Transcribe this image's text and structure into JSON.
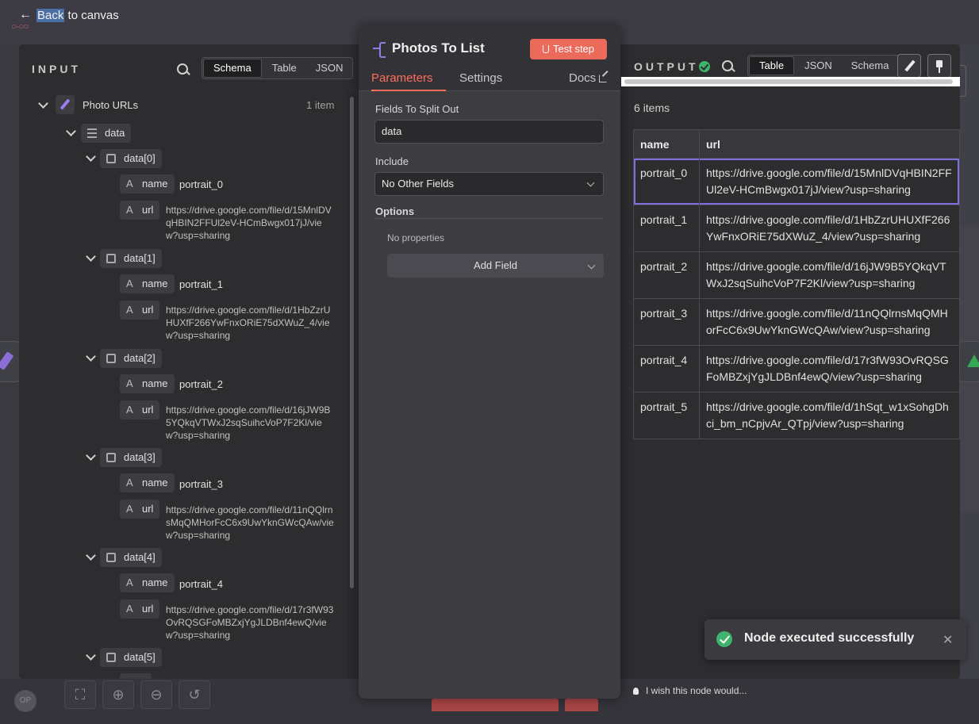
{
  "back_link": {
    "back": "Back",
    "rest": "to canvas"
  },
  "input": {
    "heading": "INPUT",
    "views": [
      "Schema",
      "Table",
      "JSON"
    ],
    "active_view": "Schema",
    "root": {
      "label": "Photo URLs",
      "count": "1 item"
    },
    "data_label": "data",
    "items": [
      {
        "label": "data[0]",
        "name_key": "name",
        "name": "portrait_0",
        "url_key": "url",
        "url": "https://drive.google.com/file/d/15MnlDVqHBIN2FFUl2eV-HCmBwgx017jJ/view?usp=sharing"
      },
      {
        "label": "data[1]",
        "name_key": "name",
        "name": "portrait_1",
        "url_key": "url",
        "url": "https://drive.google.com/file/d/1HbZzrUHUXfF266YwFnxORiE75dXWuZ_4/view?usp=sharing"
      },
      {
        "label": "data[2]",
        "name_key": "name",
        "name": "portrait_2",
        "url_key": "url",
        "url": "https://drive.google.com/file/d/16jJW9B5YQkqVTWxJ2sqSuihcVoP7F2Kl/view?usp=sharing"
      },
      {
        "label": "data[3]",
        "name_key": "name",
        "name": "portrait_3",
        "url_key": "url",
        "url": "https://drive.google.com/file/d/11nQQlrnsMqQMHorFcC6x9UwYknGWcQAw/view?usp=sharing"
      },
      {
        "label": "data[4]",
        "name_key": "name",
        "name": "portrait_4",
        "url_key": "url",
        "url": "https://drive.google.com/file/d/17r3fW93OvRQSGFoMBZxjYgJLDBnf4ewQ/view?usp=sharing"
      },
      {
        "label": "data[5]"
      }
    ]
  },
  "node": {
    "title": "Photos To List",
    "test_button": "Test step",
    "tabs": [
      "Parameters",
      "Settings"
    ],
    "docs": "Docs",
    "fields_to_split_label": "Fields To Split Out",
    "fields_to_split_value": "data",
    "include_label": "Include",
    "include_value": "No Other Fields",
    "options_label": "Options",
    "no_properties": "No properties",
    "add_field": "Add Field"
  },
  "output": {
    "heading": "OUTPUT",
    "views": [
      "Table",
      "JSON",
      "Schema"
    ],
    "active_view": "Table",
    "items_count": "6 items",
    "columns": [
      "name",
      "url"
    ],
    "rows": [
      [
        "portrait_0",
        "https://drive.google.com/file/d/15MnlDVqHBIN2FFUl2eV-HCmBwgx017jJ/view?usp=sharing"
      ],
      [
        "portrait_1",
        "https://drive.google.com/file/d/1HbZzrUHUXfF266YwFnxORiE75dXWuZ_4/view?usp=sharing"
      ],
      [
        "portrait_2",
        "https://drive.google.com/file/d/16jJW9B5YQkqVTWxJ2sqSuihcVoP7F2Kl/view?usp=sharing"
      ],
      [
        "portrait_3",
        "https://drive.google.com/file/d/11nQQlrnsMqQMHorFcC6x9UwYknGWcQAw/view?usp=sharing"
      ],
      [
        "portrait_4",
        "https://drive.google.com/file/d/17r3fW93OvRQSGFoMBZxjYgJLDBnf4ewQ/view?usp=sharing"
      ],
      [
        "portrait_5",
        "https://drive.google.com/file/d/1hSqt_w1xSohgDhci_bm_nCpjvAr_QTpj/view?usp=sharing"
      ]
    ]
  },
  "toast": {
    "message": "Node executed successfully"
  },
  "feedback": "I wish this node would...",
  "avatar_initials": "OP",
  "colors": {
    "accent": "#ff6d5a",
    "success": "#3db36b",
    "test_button": "#eb6a5c",
    "node_icon": "#8b7fe6"
  }
}
